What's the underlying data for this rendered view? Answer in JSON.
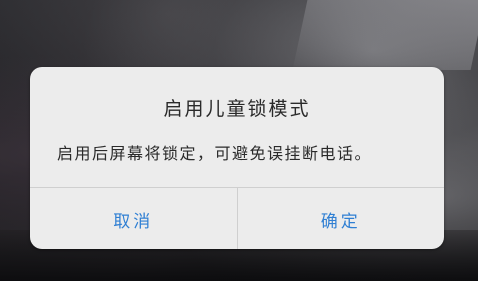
{
  "dialog": {
    "title": "启用儿童锁模式",
    "message": "启用后屏幕将锁定，可避免误挂断电话。",
    "cancel_label": "取消",
    "confirm_label": "确定"
  },
  "colors": {
    "dialog_background": "#ececec",
    "button_text": "#2f7fd3",
    "text": "#2a2a2a"
  }
}
